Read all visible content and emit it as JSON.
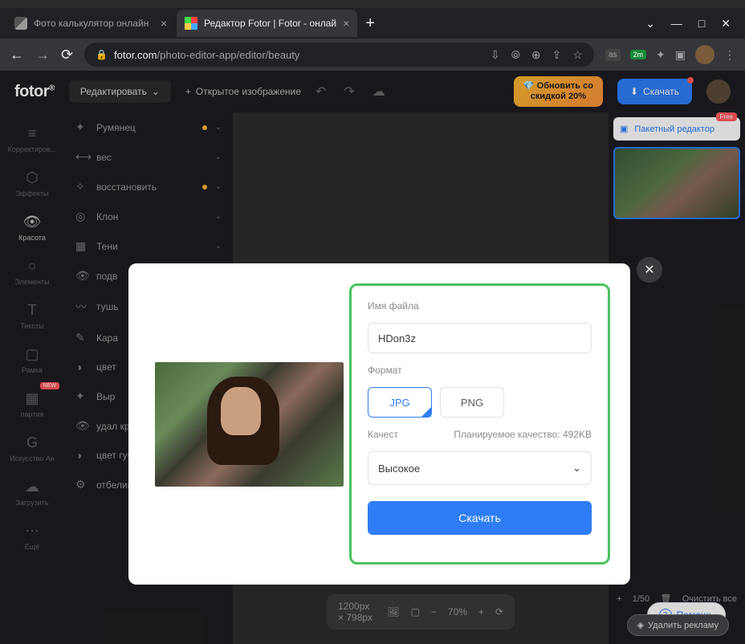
{
  "window": {
    "min": "—",
    "max": "□",
    "close": "✕",
    "chev": "⌄"
  },
  "tabs": [
    {
      "title": "Фото калькулятор онлайн",
      "active": false
    },
    {
      "title": "Редактор Fotor | Fotor - онлай",
      "active": true
    }
  ],
  "nav": {
    "back": "←",
    "fwd": "→",
    "reload": "⟳"
  },
  "address": {
    "domain": "fotor.com",
    "path": "/photo-editor-app/editor/beauty"
  },
  "addr_icons": {
    "install": "⇩",
    "translate": "⦾",
    "zoom": "⊕",
    "share": "⇪",
    "star": "☆"
  },
  "ext": {
    "as": "as",
    "m2": "2m",
    "puzzle": "✦",
    "square": "▣",
    "dots": "⋮"
  },
  "header": {
    "logo": "fotor",
    "reg": "®",
    "edit": "Редактировать",
    "open": "Открытое изображение",
    "undo": "↶",
    "redo": "↷",
    "cloud": "☁",
    "upgrade_l1": "Обновить со",
    "upgrade_l2": "скидкой 20%",
    "download": "Скачать",
    "dlicon": "⬇"
  },
  "leftside": [
    {
      "icon": "≡",
      "label": "Корректиров..."
    },
    {
      "icon": "⬡",
      "label": "Эффекты"
    },
    {
      "icon": "👁",
      "label": "Красота",
      "active": true
    },
    {
      "icon": "○",
      "label": "Элементы"
    },
    {
      "icon": "T",
      "label": "Тексты"
    },
    {
      "icon": "▢",
      "label": "Рамка"
    },
    {
      "icon": "▦",
      "label": "партия",
      "badge": "NEW"
    },
    {
      "icon": "G",
      "label": "Искусство Ан"
    },
    {
      "icon": "☁",
      "label": "Загрузить"
    },
    {
      "icon": "⋯",
      "label": "Ещё"
    }
  ],
  "tools": [
    {
      "icon": "✦",
      "label": "Румянец",
      "dot": true
    },
    {
      "icon": "⟷",
      "label": "вес"
    },
    {
      "icon": "✧",
      "label": "восстановить",
      "dot": true
    },
    {
      "icon": "◎",
      "label": "Клон"
    },
    {
      "icon": "▦",
      "label": "Тени"
    },
    {
      "icon": "👁",
      "label": "подв"
    },
    {
      "icon": "〰",
      "label": "тушь",
      "dot": true
    },
    {
      "icon": "✎",
      "label": "Кара"
    },
    {
      "icon": "◑",
      "label": "цвет"
    },
    {
      "icon": "✦",
      "label": "Выр"
    },
    {
      "icon": "👁",
      "label": "удал красн"
    },
    {
      "icon": "◑",
      "label": "цвет губ",
      "dot": true
    },
    {
      "icon": "⚙",
      "label": "отбеливание зубов",
      "dot": true
    }
  ],
  "right": {
    "batch": "Пакетный редактор",
    "free": "Free",
    "count": "1/50",
    "clear": "Очистить все",
    "trash": "🗑"
  },
  "bottom": {
    "dims": "1200px × 798px",
    "img": "🖼",
    "fit": "▢",
    "zoom": "70%",
    "hist": "⟳"
  },
  "help": {
    "icon": "?",
    "label": "Помощь"
  },
  "modal": {
    "fname_label": "Имя файла",
    "fname": "HDon3z",
    "format_label": "Формат",
    "jpg": "JPG",
    "png": "PNG",
    "quality_label": "Качест",
    "planned": "Планируемое качество: 492KB",
    "quality_val": "Высокое",
    "download": "Скачать"
  },
  "ad": {
    "icon": "◈",
    "label": "Удалить рекламу"
  }
}
